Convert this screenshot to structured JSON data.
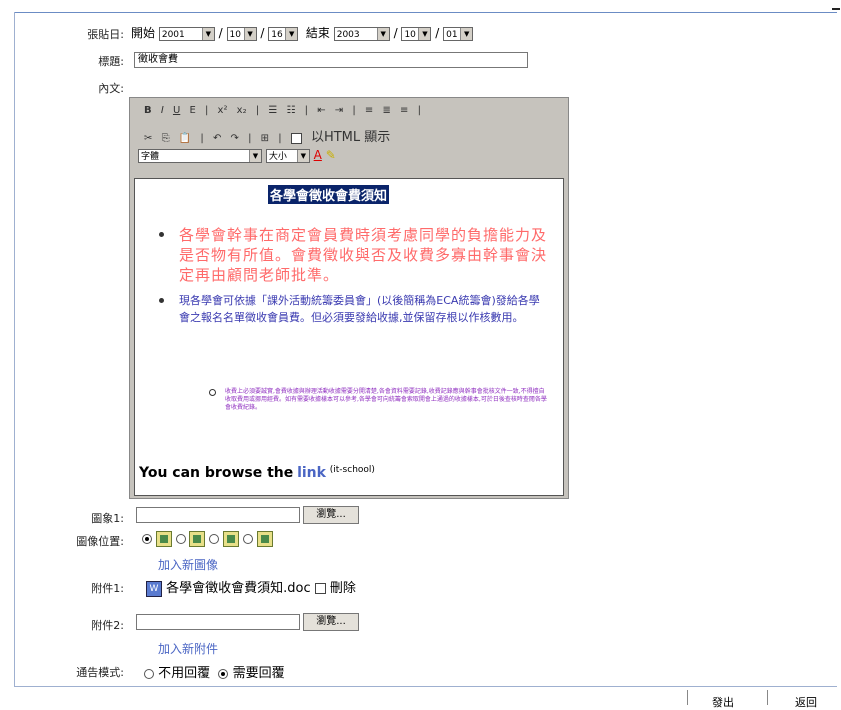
{
  "form": {
    "date_label": "張貼日:",
    "start_label": "開始",
    "start_year": "2001",
    "start_month": "10",
    "start_day": "16",
    "end_label": "結束",
    "end_year": "2003",
    "end_month": "10",
    "end_day": "01",
    "slash": "/",
    "title_label": "標題:",
    "title_value": "徵收會費",
    "content_label": "內文:",
    "image1_label": "圖象1:",
    "browse_label": "瀏覽...",
    "image_pos_label": "圖像位置:",
    "add_image_link": "加入新圖像",
    "attach1_label": "附件1:",
    "attach1_filename": "各學會徵收會費須知.doc",
    "delete_label": "刪除",
    "attach2_label": "附件2:",
    "add_attach_link": "加入新附件",
    "notice_mode_label": "通告模式:",
    "no_reply_label": "不用回覆",
    "need_reply_label": "需要回覆"
  },
  "toolbar": {
    "row1": [
      "B",
      "I",
      "U",
      "E",
      "x²",
      "x₂",
      "☰",
      "☷",
      "⇤",
      "⇥",
      "≡",
      "≣",
      "≡"
    ],
    "row2": [
      "✂",
      "⎘",
      "📋",
      "↶",
      "↷",
      "⊞"
    ],
    "html_toggle_label": "以HTML 顯示",
    "font_select": "字體",
    "size_select": "大小",
    "font_color": "A"
  },
  "editor_content": {
    "heading": "各學會徵收會費須知",
    "bullet1": "各學會幹事在商定會員費時須考慮同學的負擔能力及是否物有所值。會費徵收與否及收費多寡由幹事會決定再由顧問老師批準。",
    "bullet2": "現各學會可依據「課外活動統籌委員會」(以後簡稱為ECA統籌會)發給各學會之報名名單徵收會員費。但必須要發給收據,並保留存根以作核數用。",
    "sub_bullet": "收費上必須要誠實,會費收據與辦理活動收據需要分開清楚,各會資料需要記錄,收費記錄應與幹事會批核文件一致,不得擅自收取費用或挪用經費。如有需要收據樣本可以參考,各學會可向統籌會索取開會上通過的收據樣本,可於日後查核時查閱各學會收費紀錄。",
    "browse_text": "You can browse the",
    "link_text": "link",
    "link_note": "(it-school)"
  },
  "footer": {
    "send_label": "發出",
    "back_label": "返回"
  }
}
